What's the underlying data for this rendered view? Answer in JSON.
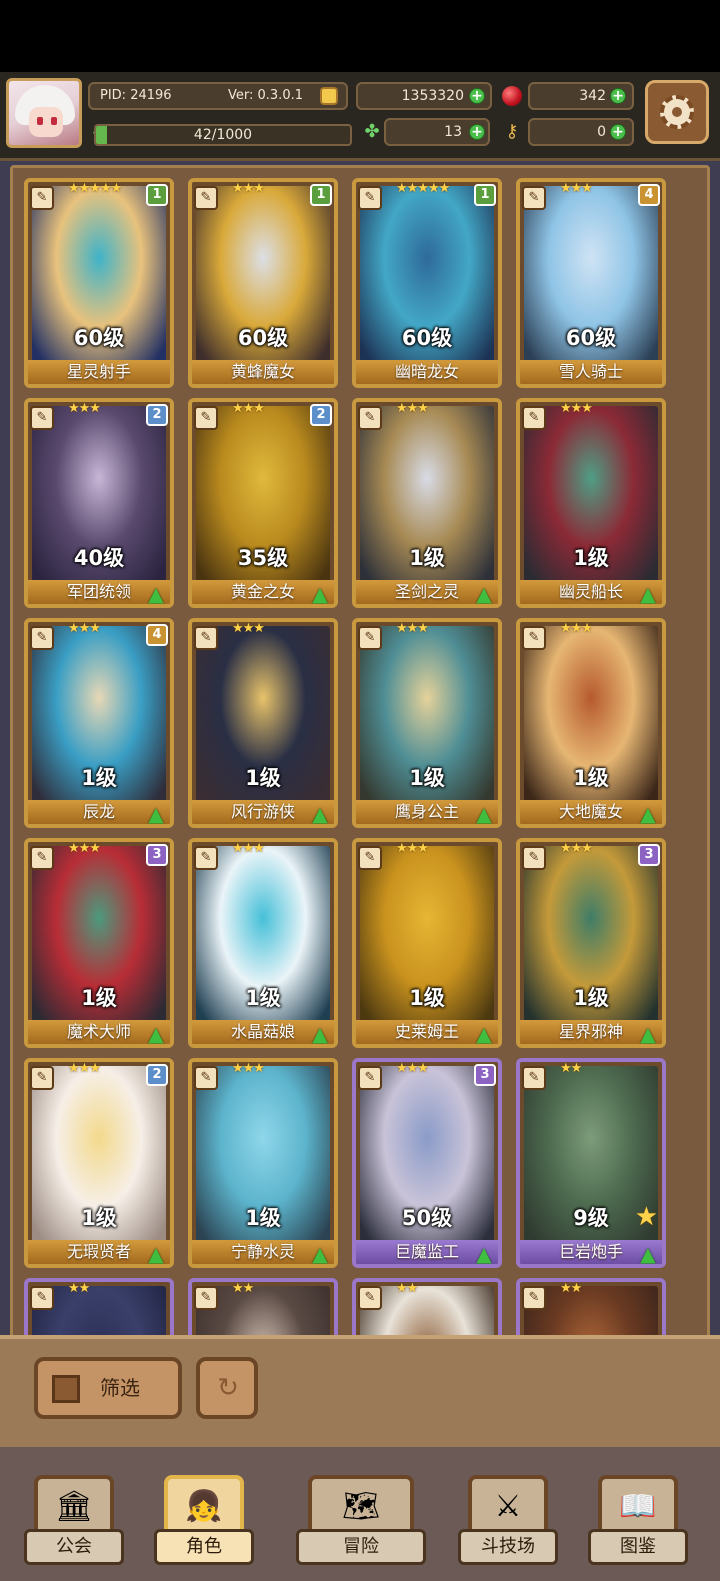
{
  "header": {
    "pid": "PID: 24196",
    "version": "Ver: 0.3.0.1",
    "gold": "1353320",
    "ruby": "342",
    "stamina": "42/1000",
    "stamina_fraction": 0.042,
    "clover": "13",
    "key": "0"
  },
  "cards": [
    {
      "name": "星灵射手",
      "level": "60级",
      "stars": "★★★★★",
      "rank": "1",
      "rank_color": "#5b9e3d",
      "frame": "gold",
      "cls": "✎",
      "art": [
        "#223063",
        "#3fb3c9",
        "#e8c27d"
      ],
      "up": false
    },
    {
      "name": "黄蜂魔女",
      "level": "60级",
      "stars": "★★★",
      "rank": "1",
      "rank_color": "#5b9e3d",
      "frame": "gold",
      "cls": "✎",
      "art": [
        "#3d2d2b",
        "#dcdfe6",
        "#d9a93a"
      ],
      "up": false
    },
    {
      "name": "幽暗龙女",
      "level": "60级",
      "stars": "★★★★★",
      "rank": "1",
      "rank_color": "#5b9e3d",
      "frame": "gold",
      "cls": "✎",
      "art": [
        "#1d3355",
        "#2e6a9a",
        "#43a7c6"
      ],
      "up": false
    },
    {
      "name": "雪人骑士",
      "level": "60级",
      "stars": "★★★",
      "rank": "4",
      "rank_color": "#c99332",
      "frame": "gold",
      "cls": "✎",
      "art": [
        "#2b3f55",
        "#cfe3f4",
        "#8fc4e6"
      ],
      "up": false
    },
    {
      "name": "军团统领",
      "level": "40级",
      "stars": "★★★",
      "rank": "2",
      "rank_color": "#5c8ec9",
      "frame": "gold",
      "cls": "✎",
      "art": [
        "#2b2440",
        "#c7b6d6",
        "#5a4a6e"
      ],
      "up": true
    },
    {
      "name": "黄金之女",
      "level": "35级",
      "stars": "★★★",
      "rank": "2",
      "rank_color": "#5c8ec9",
      "frame": "gold",
      "cls": "✎",
      "art": [
        "#4a3410",
        "#e0b93c",
        "#b98a1e"
      ],
      "up": true
    },
    {
      "name": "圣剑之灵",
      "level": "1级",
      "stars": "★★★",
      "rank": "",
      "rank_color": "",
      "frame": "gold",
      "cls": "✎",
      "art": [
        "#2d3039",
        "#d8dbe6",
        "#a78a54"
      ],
      "up": true
    },
    {
      "name": "幽灵船长",
      "level": "1级",
      "stars": "★★★",
      "rank": "",
      "rank_color": "",
      "frame": "gold",
      "cls": "✎",
      "art": [
        "#2b2b33",
        "#4f9e86",
        "#8b2a36"
      ],
      "up": true
    },
    {
      "name": "辰龙",
      "level": "1级",
      "stars": "★★★",
      "rank": "4",
      "rank_color": "#c99332",
      "frame": "gold",
      "cls": "✎",
      "art": [
        "#2f2d3a",
        "#e7d8b5",
        "#3a9ec4"
      ],
      "up": true
    },
    {
      "name": "风行游侠",
      "level": "1级",
      "stars": "★★★",
      "rank": "",
      "rank_color": "",
      "frame": "gold",
      "cls": "✎",
      "art": [
        "#3a2d33",
        "#e8c36a",
        "#2a2f45"
      ],
      "up": true
    },
    {
      "name": "鹰身公主",
      "level": "1级",
      "stars": "★★★",
      "rank": "",
      "rank_color": "",
      "frame": "gold",
      "cls": "✎",
      "art": [
        "#34382e",
        "#e5d29a",
        "#4f8e95"
      ],
      "up": true
    },
    {
      "name": "大地魔女",
      "level": "1级",
      "stars": "★★★",
      "rank": "",
      "rank_color": "",
      "frame": "gold",
      "cls": "✎",
      "art": [
        "#3b2618",
        "#b65a2e",
        "#e6b673"
      ],
      "up": true
    },
    {
      "name": "魔术大师",
      "level": "1级",
      "stars": "★★★",
      "rank": "3",
      "rank_color": "#8c63c2",
      "frame": "gold",
      "cls": "✎",
      "art": [
        "#2c2a33",
        "#4c9a7e",
        "#b82d36"
      ],
      "up": true
    },
    {
      "name": "水晶菇娘",
      "level": "1级",
      "stars": "★★★",
      "rank": "",
      "rank_color": "",
      "frame": "gold",
      "cls": "✎",
      "art": [
        "#1f3f52",
        "#46c0d8",
        "#eaf4f8"
      ],
      "up": true
    },
    {
      "name": "史莱姆王",
      "level": "1级",
      "stars": "★★★",
      "rank": "",
      "rank_color": "",
      "frame": "gold",
      "cls": "✎",
      "art": [
        "#4d3910",
        "#e6b634",
        "#c9921e"
      ],
      "up": true
    },
    {
      "name": "星界邪神",
      "level": "1级",
      "stars": "★★★",
      "rank": "3",
      "rank_color": "#8c63c2",
      "frame": "gold",
      "cls": "✎",
      "art": [
        "#23322e",
        "#3f7d67",
        "#c49a3a"
      ],
      "up": true
    },
    {
      "name": "无瑕贤者",
      "level": "1级",
      "stars": "★★★",
      "rank": "2",
      "rank_color": "#5c8ec9",
      "frame": "gold",
      "cls": "✎",
      "art": [
        "#9c8c84",
        "#f3d98c",
        "#f6efe7"
      ],
      "up": true
    },
    {
      "name": "宁静水灵",
      "level": "1级",
      "stars": "★★★",
      "rank": "",
      "rank_color": "",
      "frame": "gold",
      "cls": "✎",
      "art": [
        "#2b4352",
        "#8fd6ea",
        "#5cb4cc"
      ],
      "up": true
    },
    {
      "name": "巨魔监工",
      "level": "50级",
      "stars": "★★★",
      "rank": "3",
      "rank_color": "#8c63c2",
      "frame": "purple",
      "cls": "✎",
      "art": [
        "#2c2e3c",
        "#8a9bc8",
        "#c9c3d8"
      ],
      "up": true
    },
    {
      "name": "巨岩炮手",
      "level": "9级",
      "stars": "★★",
      "rank": "",
      "rank_color": "",
      "frame": "purple",
      "cls": "✎",
      "art": [
        "#2f3a30",
        "#7d9c7a",
        "#4d6a4f"
      ],
      "up": true,
      "fav": true
    }
  ],
  "partial_cards": [
    {
      "stars": "★★",
      "frame": "purple",
      "art": [
        "#1f2340",
        "#2b2f55",
        "#3a3f6a"
      ]
    },
    {
      "stars": "★★",
      "frame": "purple",
      "art": [
        "#3a2e2b",
        "#d8c6b8",
        "#5a4a44"
      ]
    },
    {
      "stars": "★★",
      "frame": "purple",
      "art": [
        "#3a2a1e",
        "#8a5a33",
        "#e8e2d8"
      ]
    },
    {
      "stars": "★★",
      "frame": "purple",
      "art": [
        "#3a241c",
        "#b46a3a",
        "#6a3a22"
      ]
    }
  ],
  "controls": {
    "filter_label": "筛选",
    "refresh_icon": "refresh-icon",
    "filter_icon": "grid-icon"
  },
  "tabs": [
    {
      "label": "公会",
      "icon": "🏛",
      "active": false
    },
    {
      "label": "角色",
      "icon": "👧",
      "active": true
    },
    {
      "label": "冒险",
      "icon": "🗺",
      "active": false
    },
    {
      "label": "斗技场",
      "icon": "⚔",
      "active": false
    },
    {
      "label": "图鉴",
      "icon": "📖",
      "active": false
    }
  ]
}
